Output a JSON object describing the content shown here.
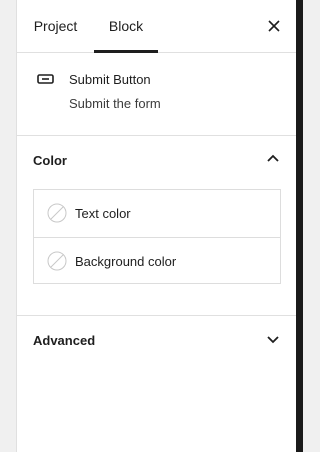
{
  "tabs": [
    {
      "label": "Project",
      "active": false
    },
    {
      "label": "Block",
      "active": true
    }
  ],
  "close_icon": "close-icon",
  "block": {
    "icon": "button-block-icon",
    "title": "Submit Button",
    "description": "Submit the form"
  },
  "color_section": {
    "title": "Color",
    "expanded": true,
    "chevron_icon": "chevron-up-icon",
    "items": [
      {
        "label": "Text color",
        "swatch_icon": "unset-color-swatch-icon"
      },
      {
        "label": "Background color",
        "swatch_icon": "unset-color-swatch-icon"
      }
    ]
  },
  "advanced_section": {
    "title": "Advanced",
    "expanded": false,
    "chevron_icon": "chevron-down-icon"
  },
  "colors": {
    "text": "#1e1e1e",
    "border": "#e0e0e0",
    "panel_bg": "#ffffff",
    "canvas_bg": "#f0f0f0"
  }
}
